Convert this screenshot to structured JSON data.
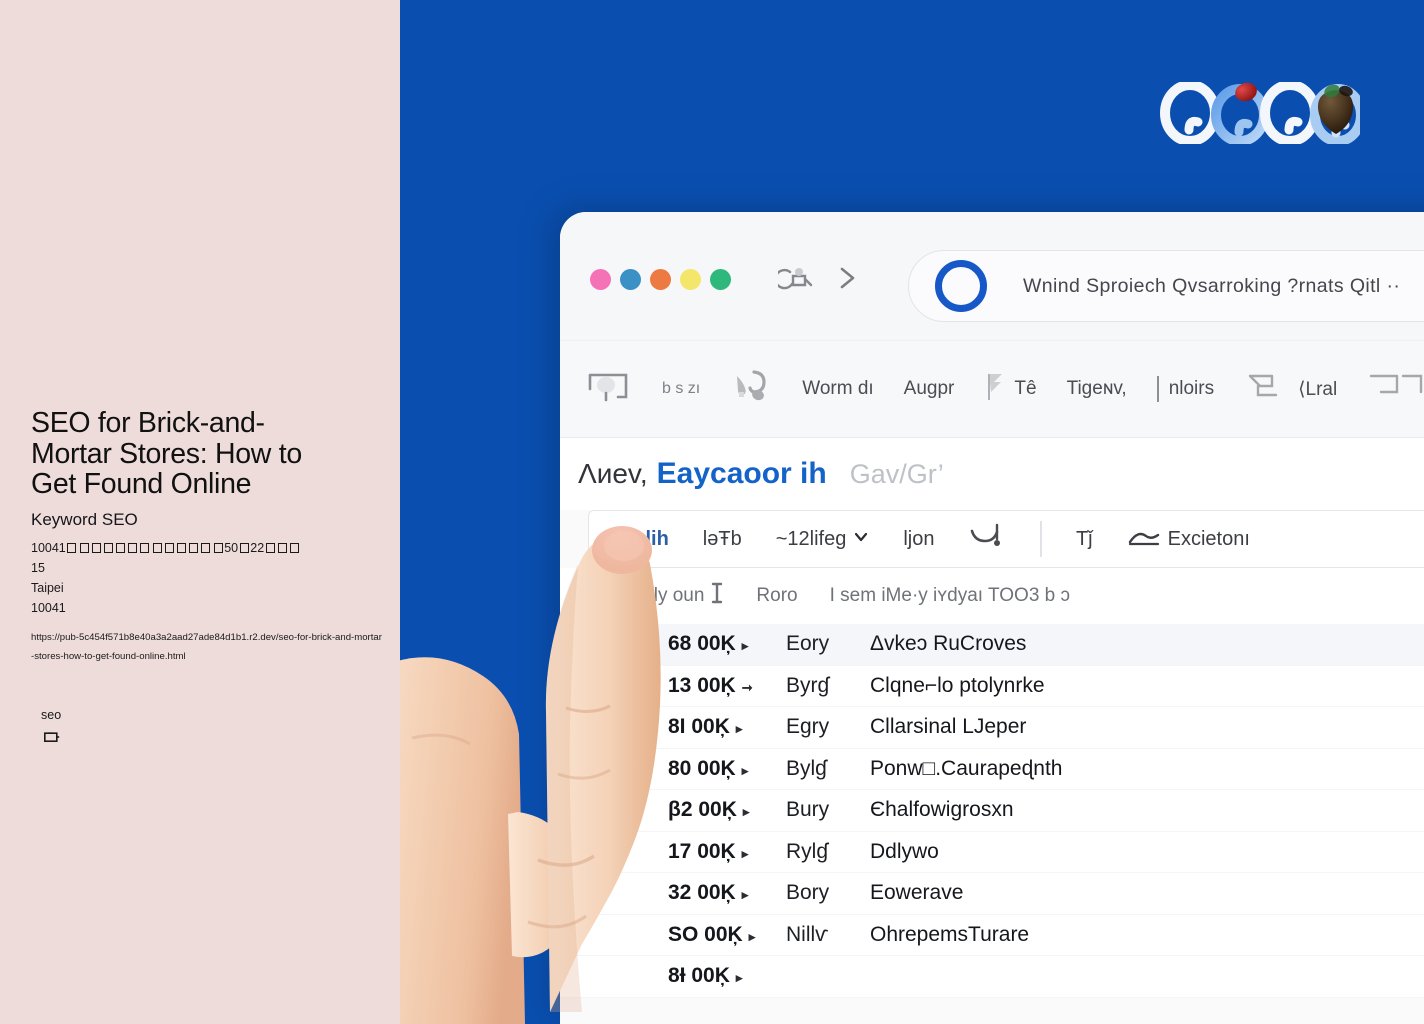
{
  "colors": {
    "left_panel_bg": "#EEDCDA",
    "blue_bg": "#0A4FB0",
    "browser_bg": "#FAFAFB",
    "accent_blue": "#1463C8",
    "row_alt_bg": "#F4F6FA"
  },
  "left_panel": {
    "title": "SEO for Brick-and-Mortar Stores: How to Get Found Online",
    "subtitle": "Keyword SEO",
    "address_prefix": "10041",
    "address_tofu_count_1": 13,
    "address_mid": "50",
    "address_tofu_count_2": 1,
    "address_mid_2": "22",
    "address_tofu_count_3": 3,
    "number": "15",
    "city": "Taipei",
    "postal_code": "10041",
    "url": "https://pub-5c454f571b8e40a3a2aad27ade84d1b1.r2.dev/seo-for-brick-and-mortar-stores-how-to-get-found-online.html",
    "tag": "seo",
    "tag_icon": "card-icon"
  },
  "logo": {
    "name": "brand-logo",
    "rings": 4
  },
  "browser": {
    "window_dots": [
      {
        "name": "dot-pink",
        "color": "#F472B6"
      },
      {
        "name": "dot-blue",
        "color": "#3B90C6"
      },
      {
        "name": "dot-orange",
        "color": "#EC7A42"
      },
      {
        "name": "dot-yellow",
        "color": "#F4E66A"
      },
      {
        "name": "dot-green",
        "color": "#2FB87C"
      }
    ],
    "nav": {
      "back_icon": "back-refresh-icon",
      "forward_icon": "chevron-right-icon"
    },
    "address_bar": {
      "ring_icon": "browser-logo-ring-icon",
      "value": "Wnind Sproiech  Qvsarroking  ?rnats   Qitl   ··"
    },
    "toolbar": [
      {
        "label": "",
        "icon": "home-glyph-icon"
      },
      {
        "label": "b s zı",
        "icon": ""
      },
      {
        "label": "",
        "icon": "tools-glyph-icon"
      },
      {
        "label": "Worm dı",
        "icon": ""
      },
      {
        "label": "Augpr",
        "icon": ""
      },
      {
        "label": "Tê",
        "icon": "flag-glyph-icon"
      },
      {
        "label": "Tigeɴv,",
        "icon": ""
      },
      {
        "label": "nloirs",
        "icon": "divider-bar"
      },
      {
        "label": "⟨Lral",
        "icon": "box-glyph-icon"
      },
      {
        "label": "",
        "icon": "panel-glyph-icon"
      }
    ],
    "page_heading": {
      "dark": "Λиev,",
      "blue": "Eaycaoor ih",
      "gray": "Gav/Gr’"
    },
    "filter_row": [
      {
        "label": "hvalih",
        "style": "blue"
      },
      {
        "label": "lǝŦb",
        "style": "dark"
      },
      {
        "label": "~12lifeg",
        "style": "dark",
        "icon": "chevron-down-icon"
      },
      {
        "label": "ljon",
        "style": "dark"
      },
      {
        "label": "",
        "style": "dark",
        "icon": "cart-glyph-icon"
      },
      {
        "label": "Tǰ",
        "style": "dark"
      },
      {
        "label": "Excietonı",
        "style": "dark",
        "icon": "curve-glyph-icon"
      }
    ],
    "sub_header": [
      {
        "label": "Hly oun",
        "icon": "text-cursor-icon"
      },
      {
        "label": "Roro",
        "icon": ""
      },
      {
        "label": "I sem iMe·y iʏdyaı TOO3 b ɔ",
        "icon": ""
      }
    ],
    "table": {
      "rows": [
        {
          "volume": "68 00Ķ",
          "kd": "Eory",
          "mid": "Δvkeɔ",
          "term": "RuCroves"
        },
        {
          "volume": "13 00Ķ",
          "kd": "Byrɠ",
          "mid": "",
          "term": "Clqne⌐lo ptolynrke"
        },
        {
          "volume": "8I 00Ķ",
          "kd": "Egry",
          "mid": "",
          "term": "Cllarsinal LJeper"
        },
        {
          "volume": "80 00Ķ",
          "kd": "Bylɠ",
          "mid": "",
          "term": "Ponw□.Caurapeɖnth"
        },
        {
          "volume": "β2 00Ķ",
          "kd": "Bury",
          "mid": "",
          "term": "Єhalfowigrosxn"
        },
        {
          "volume": "17 00Ķ",
          "kd": "Rylɠ",
          "mid": "",
          "term": "Ddlywo"
        },
        {
          "volume": "32 00Ķ",
          "kd": "Bory",
          "mid": "",
          "term": "Eowerave"
        },
        {
          "volume": "SO 00Ķ",
          "kd": "Nillѵ",
          "mid": "",
          "term": "OhrepemsTurare"
        },
        {
          "volume": "8Ɨ 00Ķ",
          "kd": "",
          "mid": "",
          "term": ""
        }
      ]
    }
  },
  "foreground": {
    "hand_image": "pointing-hand-photo"
  }
}
